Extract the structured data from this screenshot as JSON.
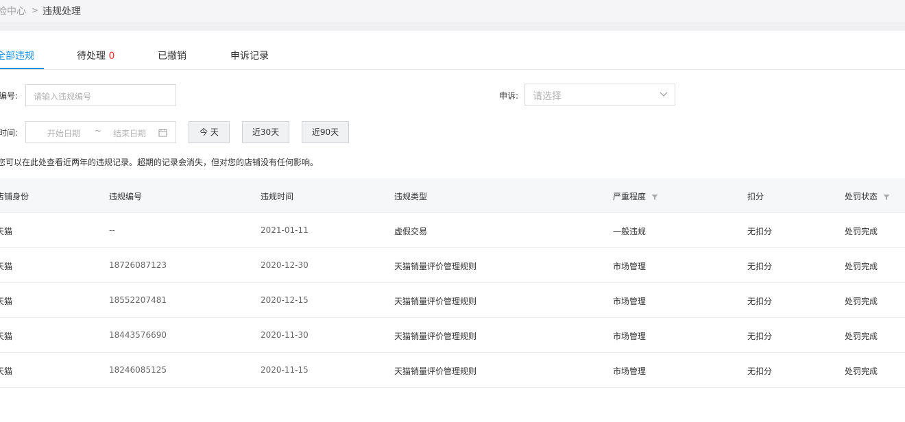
{
  "breadcrumb": {
    "parent": "检中心",
    "separator": ">",
    "current": "违规处理"
  },
  "tabs": [
    {
      "label": "全部违规",
      "active": true
    },
    {
      "label": "待处理",
      "count": "0"
    },
    {
      "label": "已撤销"
    },
    {
      "label": "申诉记录"
    }
  ],
  "filters": {
    "number_label": "编号",
    "number_placeholder": "请输入违规编号",
    "appeal_label": "申诉",
    "appeal_placeholder": "请选择",
    "time_label": "时间",
    "start_placeholder": "开始日期",
    "range_separator": "~",
    "end_placeholder": "结束日期",
    "quick_buttons": [
      "今 天",
      "近30天",
      "近90天"
    ]
  },
  "hint": "您可以在此处查看近两年的违规记录。超期的记录会消失，但对您的店铺没有任何影响。",
  "table": {
    "columns": [
      "店铺身份",
      "违规编号",
      "违规时间",
      "违规类型",
      "严重程度",
      "扣分",
      "处罚状态"
    ],
    "rows": [
      [
        "天猫",
        "--",
        "2021-01-11",
        "虚假交易",
        "一般违规",
        "无扣分",
        "处罚完成"
      ],
      [
        "天猫",
        "18726087123",
        "2020-12-30",
        "天猫销量评价管理规则",
        "市场管理",
        "无扣分",
        "处罚完成"
      ],
      [
        "天猫",
        "18552207481",
        "2020-12-15",
        "天猫销量评价管理规则",
        "市场管理",
        "无扣分",
        "处罚完成"
      ],
      [
        "天猫",
        "18443576690",
        "2020-11-30",
        "天猫销量评价管理规则",
        "市场管理",
        "无扣分",
        "处罚完成"
      ],
      [
        "天猫",
        "18246085125",
        "2020-11-15",
        "天猫销量评价管理规则",
        "市场管理",
        "无扣分",
        "处罚完成"
      ]
    ]
  },
  "colors": {
    "accent": "#1a90e0",
    "count": "#ff2a2a"
  }
}
